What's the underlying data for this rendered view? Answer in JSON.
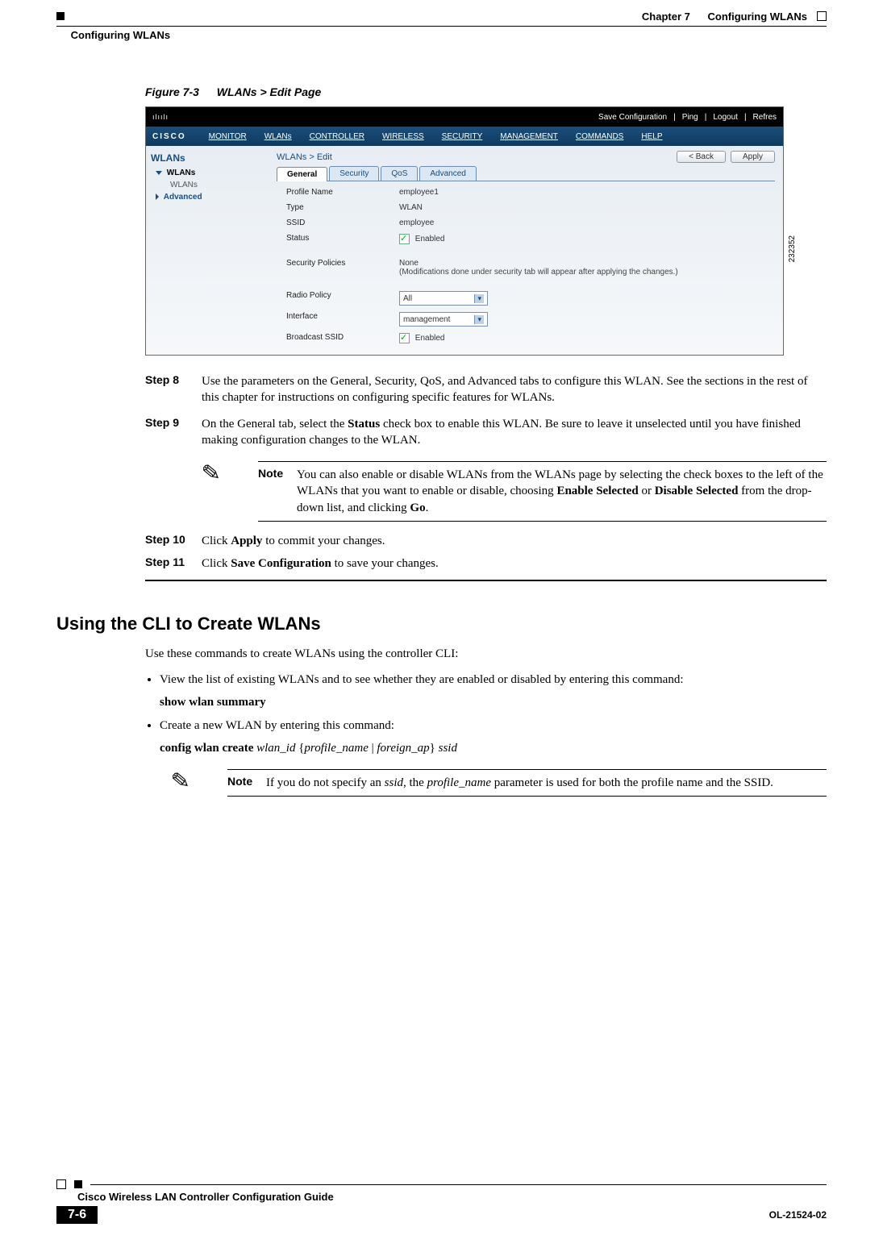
{
  "header": {
    "chapter": "Chapter 7",
    "chapter_title": "Configuring WLANs",
    "section": "Configuring WLANs"
  },
  "figure": {
    "number": "Figure 7-3",
    "title": "WLANs > Edit Page",
    "image_number": "232352",
    "topbar": {
      "save_config": "Save Configuration",
      "ping": "Ping",
      "logout": "Logout",
      "refresh": "Refres"
    },
    "brand_bars": "ılıılı",
    "brand": "CISCO",
    "menu": [
      "MONITOR",
      "WLANs",
      "CONTROLLER",
      "WIRELESS",
      "SECURITY",
      "MANAGEMENT",
      "COMMANDS",
      "HELP"
    ],
    "sidebar": {
      "title": "WLANs",
      "items": [
        {
          "label": "WLANs",
          "expanded": true
        },
        {
          "label": "WLANs",
          "child": true
        },
        {
          "label": "Advanced",
          "expanded": false
        }
      ]
    },
    "main": {
      "breadcrumb": "WLANs > Edit",
      "back_btn": "< Back",
      "apply_btn": "Apply",
      "tabs": [
        "General",
        "Security",
        "QoS",
        "Advanced"
      ],
      "active_tab": "General",
      "fields": {
        "profile_name_label": "Profile Name",
        "profile_name_value": "employee1",
        "type_label": "Type",
        "type_value": "WLAN",
        "ssid_label": "SSID",
        "ssid_value": "employee",
        "status_label": "Status",
        "status_value": "Enabled",
        "security_label": "Security Policies",
        "security_value": "None",
        "security_note": "(Modifications done under security tab will appear after applying the changes.)",
        "radio_label": "Radio Policy",
        "radio_value": "All",
        "interface_label": "Interface",
        "interface_value": "management",
        "broadcast_label": "Broadcast SSID",
        "broadcast_value": "Enabled"
      }
    }
  },
  "steps": {
    "s8_label": "Step 8",
    "s8_text": "Use the parameters on the General, Security, QoS, and Advanced tabs to configure this WLAN. See the sections in the rest of this chapter for instructions on configuring specific features for WLANs.",
    "s9_label": "Step 9",
    "s9_pre": "On the General tab, select the ",
    "s9_bold": "Status",
    "s9_post": " check box to enable this WLAN. Be sure to leave it unselected until you have finished making configuration changes to the WLAN.",
    "note1_label": "Note",
    "note1_pre": "You can also enable or disable WLANs from the WLANs page by selecting the check boxes to the left of the WLANs that you want to enable or disable, choosing ",
    "note1_b1": "Enable Selected",
    "note1_mid": " or ",
    "note1_b2": "Disable Selected",
    "note1_mid2": " from the drop-down list, and clicking ",
    "note1_b3": "Go",
    "note1_end": ".",
    "s10_label": "Step 10",
    "s10_pre": "Click ",
    "s10_b": "Apply",
    "s10_post": " to commit your changes.",
    "s11_label": "Step 11",
    "s11_pre": "Click ",
    "s11_b": "Save Configuration",
    "s11_post": " to save your changes."
  },
  "cli": {
    "heading": "Using the CLI to Create WLANs",
    "intro": "Use these commands to create WLANs using the controller CLI:",
    "b1": "View the list of existing WLANs and to see whether they are enabled or disabled by entering this command:",
    "b1_cmd": "show wlan summary",
    "b2": "Create a new WLAN by entering this command:",
    "b2_cmd_b": "config wlan create ",
    "b2_cmd_i1": "wlan_id",
    "b2_cmd_m": " {",
    "b2_cmd_i2": "profile_name",
    "b2_cmd_sep": " | ",
    "b2_cmd_i3": "foreign_ap",
    "b2_cmd_m2": "} ",
    "b2_cmd_i4": "ssid",
    "note2_label": "Note",
    "note2_pre": "If you do not specify an ",
    "note2_i1": "ssid",
    "note2_mid": ", the ",
    "note2_i2": "profile_name",
    "note2_post": " parameter is used for both the profile name and the SSID."
  },
  "footer": {
    "book": "Cisco Wireless LAN Controller Configuration Guide",
    "page": "7-6",
    "doc": "OL-21524-02"
  }
}
